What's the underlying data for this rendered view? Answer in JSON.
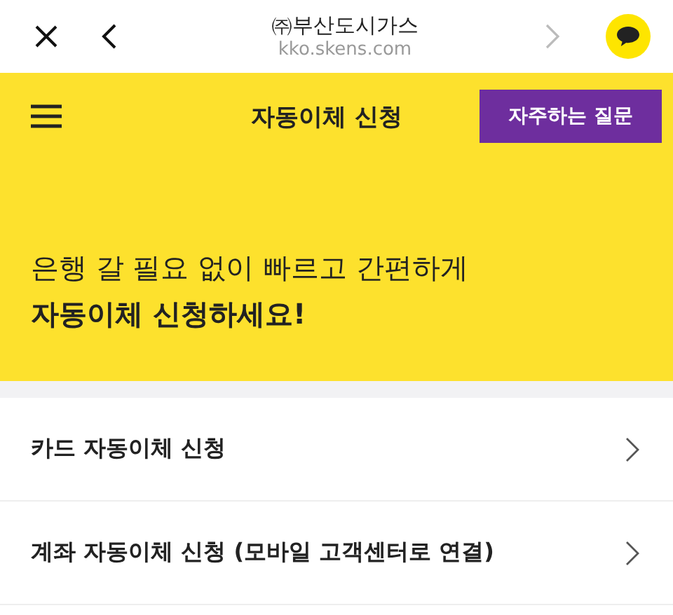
{
  "browser_bar": {
    "site_title": "㈜부산도시가스",
    "url": "kko.skens.com",
    "forward_disabled": true
  },
  "header": {
    "title": "자동이체 신청",
    "faq_button": "자주하는 질문"
  },
  "banner": {
    "lines": [
      {
        "text": "은행 갈 필요 없이 빠르고 간편하게",
        "bold": false
      },
      {
        "text": "자동이체 신청하세요!",
        "bold": true
      }
    ]
  },
  "menu_items": [
    {
      "label": "카드 자동이체 신청"
    },
    {
      "label": "계좌 자동이체 신청 (모바일 고객센터로 연결)"
    }
  ]
}
